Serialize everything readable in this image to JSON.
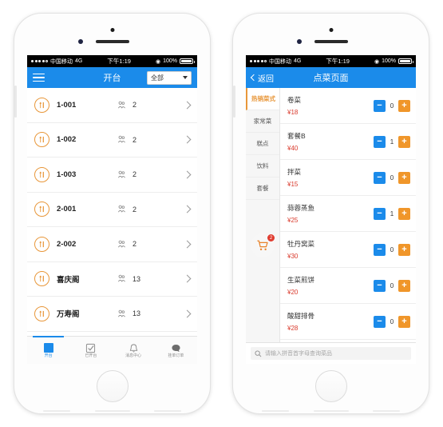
{
  "status_bar": {
    "carrier": "中国移动",
    "network": "4G",
    "time": "下午1:19",
    "battery": "100%",
    "signal_dots": 5,
    "signal_filled": 4
  },
  "left_phone": {
    "nav": {
      "menu_icon": "hamburger-icon",
      "title": "开台",
      "filter_value": "全部"
    },
    "tables": [
      {
        "name": "1-001",
        "people": "2"
      },
      {
        "name": "1-002",
        "people": "2"
      },
      {
        "name": "1-003",
        "people": "2"
      },
      {
        "name": "2-001",
        "people": "2"
      },
      {
        "name": "2-002",
        "people": "2"
      },
      {
        "name": "喜庆阁",
        "people": "13"
      },
      {
        "name": "万寿阁",
        "people": "13"
      }
    ],
    "tabs": [
      {
        "label": "开台",
        "icon": "square-icon",
        "active": true
      },
      {
        "label": "已开台",
        "icon": "checklist-icon",
        "active": false
      },
      {
        "label": "消息中心",
        "icon": "bell-icon",
        "active": false
      },
      {
        "label": "挂单订单",
        "icon": "chat-icon",
        "active": false
      }
    ]
  },
  "right_phone": {
    "nav": {
      "back_label": "返回",
      "title": "点菜页面"
    },
    "categories": [
      {
        "label": "热销菜式",
        "active": true
      },
      {
        "label": "家常菜",
        "active": false
      },
      {
        "label": "糕点",
        "active": false
      },
      {
        "label": "饮料",
        "active": false
      },
      {
        "label": "套餐",
        "active": false
      }
    ],
    "cart": {
      "icon": "shopping-cart-icon",
      "badge": "2"
    },
    "dishes": [
      {
        "name": "卷菜",
        "price": "¥18",
        "qty": "0"
      },
      {
        "name": "套餐B",
        "price": "¥40",
        "qty": "1"
      },
      {
        "name": "拌菜",
        "price": "¥15",
        "qty": "0"
      },
      {
        "name": "蒜蓉蒸鱼",
        "price": "¥25",
        "qty": "1"
      },
      {
        "name": "牡丹窝菜",
        "price": "¥30",
        "qty": "0"
      },
      {
        "name": "生菜煎饼",
        "price": "¥20",
        "qty": "0"
      },
      {
        "name": "酸甜排骨",
        "price": "¥28",
        "qty": "0"
      }
    ],
    "stepper": {
      "minus_label": "−",
      "plus_label": "+"
    },
    "search": {
      "icon": "search-icon",
      "placeholder": "请输入拼音首字母查询菜品"
    }
  },
  "colors": {
    "nav_blue": "#1b8bea",
    "accent_orange": "#e8973a",
    "plus_orange": "#f0962a",
    "price_red": "#d9392b",
    "badge_red": "#e03b2f"
  }
}
